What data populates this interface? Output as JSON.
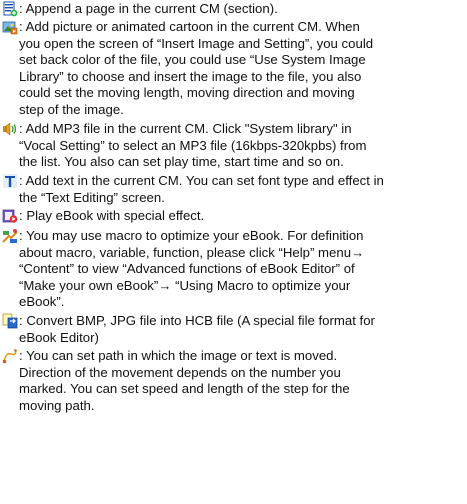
{
  "entries": [
    {
      "icon": "append-page-icon",
      "lines": [
        ": Append a page in the current CM (section)."
      ]
    },
    {
      "icon": "add-picture-icon",
      "lines": [
        ": Add picture or animated cartoon in the current CM. When",
        "you open the screen of “Insert Image and Setting”, you could",
        "set back color of the file, you could use “Use System Image",
        "Library” to choose and insert the image to the file, you also",
        "could set the moving length, moving direction and moving",
        "step of the image."
      ]
    },
    {
      "icon": "add-mp3-icon",
      "lines": [
        ": Add MP3 file in the current CM. Click \"System library\" in",
        "“Vocal Setting” to select an MP3 file (16kbps-320kpbs) from",
        "the list. You also can set play time, start time and so on."
      ]
    },
    {
      "icon": "add-text-icon",
      "lines": [
        ": Add text in the current CM. You can set font type and effect in",
        "the “Text Editing” screen."
      ]
    },
    {
      "icon": "play-ebook-icon",
      "lines": [
        ": Play eBook with special effect."
      ]
    },
    {
      "icon": "macro-icon",
      "lines": [
        ": You may use macro to optimize your eBook. For definition",
        "about macro, variable, function, please click “Help” menu→",
        "“Content” to view “Advanced functions of eBook Editor” of",
        "“Make your own eBook”→ “Using Macro to optimize your",
        "eBook”."
      ]
    },
    {
      "icon": "convert-image-icon",
      "lines": [
        ": Convert BMP, JPG file into HCB file (A special file format for",
        "eBook Editor)"
      ]
    },
    {
      "icon": "moving-path-icon",
      "lines": [
        ": You can set path in which the image or text is moved.",
        "Direction of the movement depends on the number you",
        "marked. You can set speed and length of the step for the",
        "moving path."
      ]
    }
  ]
}
